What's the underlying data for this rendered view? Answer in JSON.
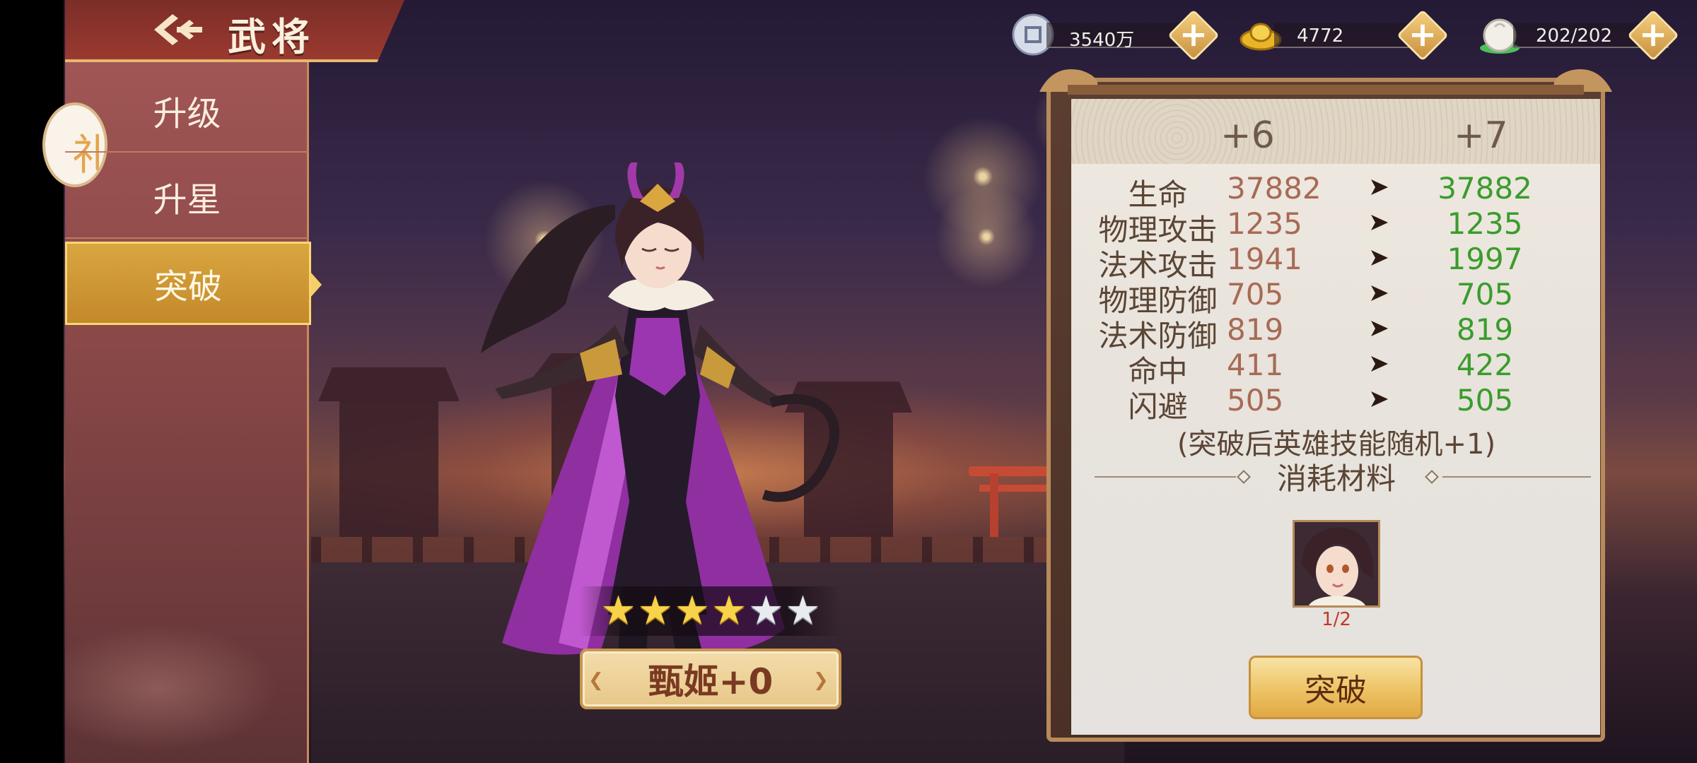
{
  "header": {
    "title": "武将"
  },
  "side_round_glyph": "礼",
  "nav": {
    "items": [
      {
        "label": "升级",
        "active": false
      },
      {
        "label": "升星",
        "active": false
      },
      {
        "label": "突破",
        "active": true
      }
    ]
  },
  "currencies": [
    {
      "name": "silver-coin",
      "value": "3540万"
    },
    {
      "name": "gold-ingot",
      "value": "4772"
    },
    {
      "name": "stamina-bun",
      "value": "202/202"
    }
  ],
  "hero": {
    "name": "甄姬+0",
    "stars_total": 6,
    "stars_filled": 4
  },
  "breakthrough": {
    "current_level": "+6",
    "next_level": "+7",
    "stats": [
      {
        "label": "生命",
        "current": "37882",
        "next": "37882"
      },
      {
        "label": "物理攻击",
        "current": "1235",
        "next": "1235"
      },
      {
        "label": "法术攻击",
        "current": "1941",
        "next": "1997"
      },
      {
        "label": "物理防御",
        "current": "705",
        "next": "705"
      },
      {
        "label": "法术防御",
        "current": "819",
        "next": "819"
      },
      {
        "label": "命中",
        "current": "411",
        "next": "422"
      },
      {
        "label": "闪避",
        "current": "505",
        "next": "505"
      }
    ],
    "note": "(突破后英雄技能随机+1)",
    "materials_title": "消耗材料",
    "material_count": "1/2",
    "button_label": "突破"
  },
  "colors": {
    "stat_current": "#a86a55",
    "stat_next": "#3a9c2c",
    "active_tab": "#d9a640",
    "star_on": "#f6d34a"
  }
}
